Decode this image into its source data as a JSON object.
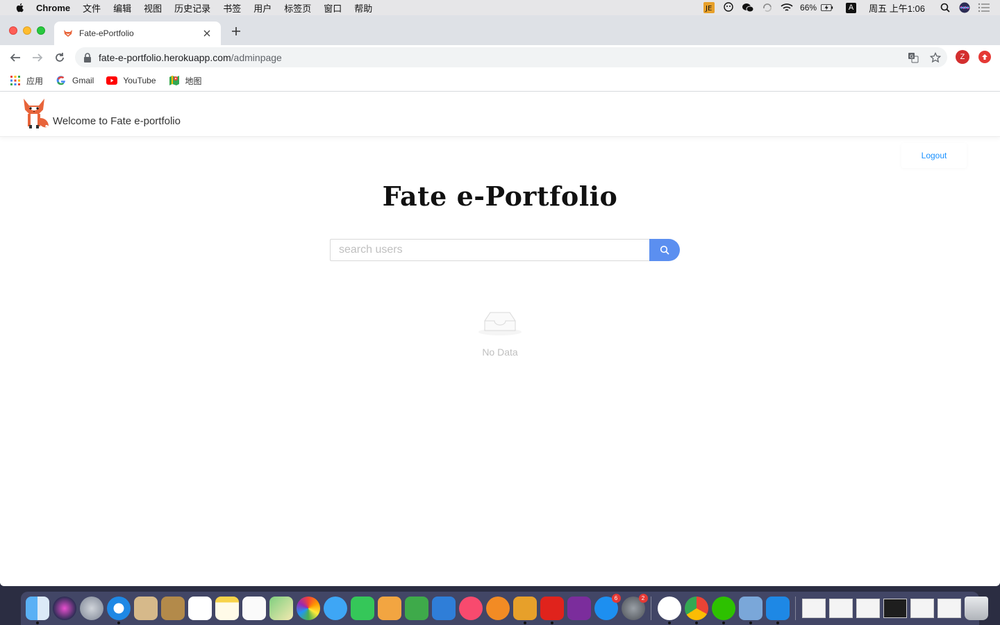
{
  "menubar": {
    "app_name": "Chrome",
    "items": [
      "文件",
      "编辑",
      "视图",
      "历史记录",
      "书签",
      "用户",
      "标签页",
      "窗口",
      "帮助"
    ],
    "battery": "66%",
    "ime": "A",
    "clock": "周五 上午1:06"
  },
  "browser": {
    "tab_title": "Fate-ePortfolio",
    "url_host": "fate-e-portfolio.herokuapp.com",
    "url_path": "/adminpage",
    "profile_initial": "Z",
    "bookmarks": [
      {
        "label": "应用",
        "icon": "apps-grid-icon"
      },
      {
        "label": "Gmail",
        "icon": "google-icon"
      },
      {
        "label": "YouTube",
        "icon": "youtube-icon"
      },
      {
        "label": "地图",
        "icon": "maps-icon"
      }
    ]
  },
  "site": {
    "welcome": "Welcome to Fate e-portfolio",
    "logout": "Logout",
    "title": "Fate e-Portfolio",
    "search_placeholder": "search users",
    "empty_text": "No Data"
  },
  "dock": {
    "badges": {
      "app_store": "6",
      "system_prefs": "2"
    },
    "colors": {
      "accent": "#5b8ff0",
      "link": "#1890ff"
    }
  }
}
